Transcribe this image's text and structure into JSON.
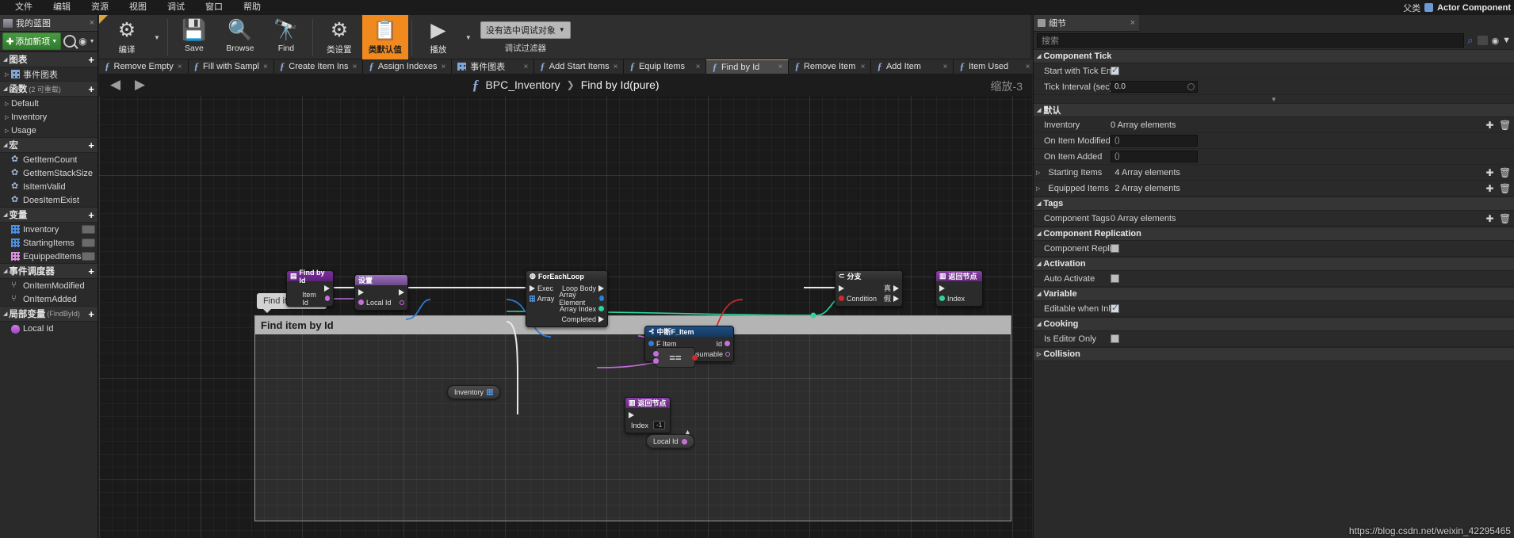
{
  "menubar": {
    "items": [
      "文件",
      "编辑",
      "资源",
      "视图",
      "调试",
      "窗口",
      "帮助"
    ],
    "right_class_label": "父类",
    "right_actor_label": "Actor Component"
  },
  "left_panel": {
    "tab_title": "我的蓝图",
    "tab_close": "×",
    "add_new_label": "添加新项",
    "add_new_caret": "▼",
    "search_icon": "search-icon",
    "eye_icon": "◉",
    "eye_caret": "▼",
    "sections": [
      {
        "title": "图表",
        "sub": "",
        "plus": "+",
        "items": [
          {
            "label": "事件图表",
            "icon": "event-graph-icon",
            "tri": "▷"
          }
        ]
      },
      {
        "title": "函数",
        "sub": "(2 可重载)",
        "plus": "+",
        "items": [
          {
            "label": "Default",
            "icon": "",
            "tri": "▷"
          },
          {
            "label": "Inventory",
            "icon": "",
            "tri": "▷"
          },
          {
            "label": "Usage",
            "icon": "",
            "tri": "▷"
          }
        ]
      },
      {
        "title": "宏",
        "sub": "",
        "plus": "+",
        "items": [
          {
            "label": "GetItemCount",
            "icon": "gear-icon",
            "tri": ""
          },
          {
            "label": "GetItemStackSize",
            "icon": "gear-icon",
            "tri": ""
          },
          {
            "label": "IsItemValid",
            "icon": "gear-icon",
            "tri": ""
          },
          {
            "label": "DoesItemExist",
            "icon": "gear-icon",
            "tri": ""
          }
        ]
      },
      {
        "title": "变量",
        "sub": "",
        "plus": "+",
        "items": [
          {
            "label": "Inventory",
            "icon": "array-blue-icon",
            "tri": "",
            "pill": true
          },
          {
            "label": "StartingItems",
            "icon": "array-blue-icon",
            "tri": "",
            "pill": true
          },
          {
            "label": "EquippedItems",
            "icon": "array-pink-icon",
            "tri": "",
            "pill": true
          }
        ]
      },
      {
        "title": "事件调度器",
        "sub": "",
        "plus": "+",
        "items": [
          {
            "label": "OnItemModified",
            "icon": "dispatcher-icon",
            "tri": ""
          },
          {
            "label": "OnItemAdded",
            "icon": "dispatcher-icon",
            "tri": ""
          }
        ]
      },
      {
        "title": "局部变量",
        "sub": "(FindById)",
        "plus": "+",
        "items": [
          {
            "label": "Local Id",
            "icon": "local-var-icon",
            "tri": ""
          }
        ]
      }
    ]
  },
  "toolbar": {
    "buttons": [
      {
        "label": "编译",
        "icon": "compile-gears-icon",
        "has_caret": true,
        "active": false
      },
      {
        "label": "Save",
        "icon": "floppy-disk-icon",
        "has_caret": false,
        "active": false
      },
      {
        "label": "Browse",
        "icon": "magnifier-icon",
        "has_caret": false,
        "active": false
      },
      {
        "label": "Find",
        "icon": "binoculars-icon",
        "has_caret": false,
        "active": false
      },
      {
        "label": "类设置",
        "icon": "class-settings-icon",
        "has_caret": false,
        "active": false
      },
      {
        "label": "类默认值",
        "icon": "class-defaults-icon",
        "has_caret": false,
        "active": true
      },
      {
        "label": "播放",
        "icon": "play-triangle-icon",
        "has_caret": true,
        "active": false
      }
    ],
    "debug_object": "没有选中调试对象",
    "debug_caret": "▼",
    "debug_filter_label": "调试过滤器"
  },
  "tabstrip": {
    "tabs": [
      {
        "label": "Remove Empty",
        "icon": "function-icon",
        "selected": false,
        "close": "×"
      },
      {
        "label": "Fill with Sampl",
        "icon": "function-icon",
        "selected": false,
        "close": "×"
      },
      {
        "label": "Create Item Ins",
        "icon": "function-icon",
        "selected": false,
        "close": "×"
      },
      {
        "label": "Assign Indexes",
        "icon": "function-icon",
        "selected": false,
        "close": "×"
      },
      {
        "label": "事件图表",
        "icon": "event-graph-icon",
        "selected": false,
        "close": "×"
      },
      {
        "label": "Add Start Items",
        "icon": "function-icon",
        "selected": false,
        "close": "×"
      },
      {
        "label": "Equip Items",
        "icon": "function-icon",
        "selected": false,
        "close": "×"
      },
      {
        "label": "Find by Id",
        "icon": "function-icon",
        "selected": true,
        "close": "×"
      },
      {
        "label": "Remove Item",
        "icon": "function-icon",
        "selected": false,
        "close": "×"
      },
      {
        "label": "Add Item",
        "icon": "function-icon",
        "selected": false,
        "close": "×"
      },
      {
        "label": "Item Used",
        "icon": "function-icon",
        "selected": false,
        "close": "×"
      }
    ]
  },
  "graph": {
    "back_arrow": "◀",
    "forward_arrow": "▶",
    "breadcrumb_icon": "function-icon",
    "breadcrumb_root": "BPC_Inventory",
    "breadcrumb_sep": "❯",
    "breadcrumb_leaf": "Find by Id(pure)",
    "zoom_label": "缩放-3",
    "comment_title": "Find item by Id",
    "tooltip_text": "Find item by Id",
    "nodes": [
      {
        "id": "find_by_id",
        "title": "Find by Id",
        "header_icon": "function-entry-icon",
        "rows": [
          {
            "left": "",
            "right": "",
            "left_pin": "",
            "right_pin": "exec"
          },
          {
            "left": "",
            "right": "Item Id",
            "left_pin": "",
            "right_pin": "purple-dot"
          }
        ]
      },
      {
        "id": "set_local_id",
        "title": "设置",
        "header_icon": "",
        "rows": [
          {
            "left": "",
            "right": "",
            "left_pin": "exec",
            "right_pin": "exec"
          },
          {
            "left": "Local Id",
            "right": "",
            "left_pin": "purple-dot",
            "right_pin": "purple-hollow"
          }
        ]
      },
      {
        "id": "foreach",
        "title": "ForEachLoop",
        "header_icon": "macro-icon",
        "rows": [
          {
            "left": "Exec",
            "right": "Loop Body",
            "left_pin": "exec",
            "right_pin": "exec"
          },
          {
            "left": "Array",
            "right": "Array Element",
            "left_pin": "array-grid",
            "right_pin": "blue-dot"
          },
          {
            "left": "",
            "right": "Array Index",
            "left_pin": "",
            "right_pin": "green-dot"
          },
          {
            "left": "",
            "right": "Completed",
            "left_pin": "",
            "right_pin": "exec"
          }
        ]
      },
      {
        "id": "break_f_item",
        "title": "中断F_Item",
        "header_icon": "break-struct-icon",
        "rows": [
          {
            "left": "F Item",
            "right": "Id",
            "left_pin": "blue-dot",
            "right_pin": "purple-dot"
          },
          {
            "left": "",
            "right": "Is Consumable",
            "left_pin": "",
            "right_pin": "purple-hollow"
          }
        ]
      },
      {
        "id": "equals",
        "title": "==",
        "header_icon": "",
        "rows": []
      },
      {
        "id": "branch",
        "title": "分支",
        "header_icon": "branch-icon",
        "rows": [
          {
            "left": "",
            "right": "真",
            "left_pin": "exec",
            "right_pin": "exec"
          },
          {
            "left": "Condition",
            "right": "假",
            "left_pin": "red-dot",
            "right_pin": "exec"
          }
        ]
      },
      {
        "id": "return_node_top",
        "title": "返回节点",
        "header_icon": "return-icon",
        "rows": [
          {
            "left": "",
            "right": "",
            "left_pin": "exec",
            "right_pin": ""
          },
          {
            "left": "Index",
            "right": "",
            "left_pin": "green-dot",
            "right_pin": ""
          }
        ]
      },
      {
        "id": "return_node_bottom",
        "title": "返回节点",
        "header_icon": "return-icon",
        "rows": [
          {
            "left": "",
            "right": "",
            "left_pin": "exec",
            "right_pin": ""
          },
          {
            "left": "Index",
            "right": "",
            "left_pin": "green-dot",
            "right_pin": "",
            "value": "-1"
          }
        ]
      }
    ],
    "var_pills": [
      {
        "id": "inventory_pill",
        "label": "Inventory",
        "icon": "array-blue-icon"
      },
      {
        "id": "local_id_pill",
        "label": "Local Id",
        "icon": "purple-dot"
      }
    ]
  },
  "details_panel": {
    "tab_title": "细节",
    "tab_close": "×",
    "search_placeholder": "搜索",
    "search_value": "",
    "grid_icon": "grid-view-icon",
    "eye_icon": "◉",
    "eye_caret": "▼",
    "categories": [
      {
        "title": "Component Tick",
        "props": [
          {
            "name": "Start with Tick En",
            "type": "checkbox",
            "checked": true
          },
          {
            "name": "Tick Interval (sec)",
            "type": "number",
            "value": "0.0"
          }
        ]
      },
      {
        "title": "默认",
        "props": [
          {
            "name": "Inventory",
            "type": "array",
            "value": "0 Array elements",
            "expandable": false,
            "buttons": [
              "+",
              "🗑"
            ]
          },
          {
            "name": "On Item Modified",
            "type": "field",
            "value": "()",
            "buttons": []
          },
          {
            "name": "On Item Added",
            "type": "field",
            "value": "()",
            "buttons": []
          },
          {
            "name": "Starting Items",
            "type": "array",
            "value": "4 Array elements",
            "expandable": true,
            "buttons": [
              "+",
              "🗑"
            ]
          },
          {
            "name": "Equipped Items",
            "type": "array",
            "value": "2 Array elements",
            "expandable": true,
            "buttons": [
              "+",
              "🗑"
            ]
          }
        ]
      },
      {
        "title": "Tags",
        "props": [
          {
            "name": "Component Tags",
            "type": "array",
            "value": "0 Array elements",
            "expandable": false,
            "buttons": [
              "+",
              "🗑"
            ]
          }
        ]
      },
      {
        "title": "Component Replication",
        "props": [
          {
            "name": "Component Replic",
            "type": "checkbox",
            "checked": false
          }
        ]
      },
      {
        "title": "Activation",
        "props": [
          {
            "name": "Auto Activate",
            "type": "checkbox",
            "checked": false
          }
        ]
      },
      {
        "title": "Variable",
        "props": [
          {
            "name": "Editable when Inh",
            "type": "checkbox",
            "checked": true
          }
        ]
      },
      {
        "title": "Cooking",
        "props": [
          {
            "name": "Is Editor Only",
            "type": "checkbox",
            "checked": false
          }
        ]
      },
      {
        "title": "Collision",
        "props": []
      }
    ]
  },
  "watermark": "https://blog.csdn.net/weixin_42295465"
}
